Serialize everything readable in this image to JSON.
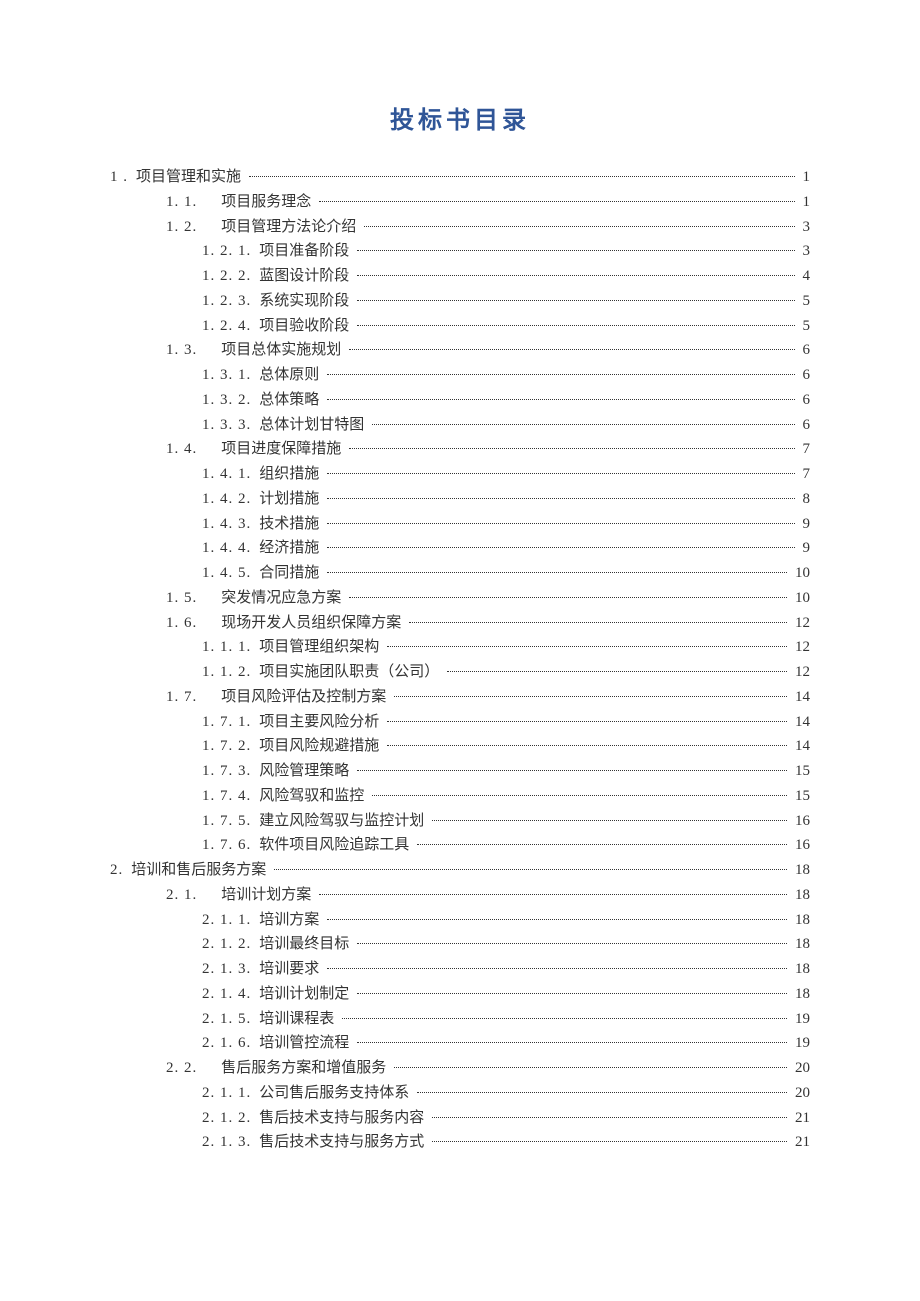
{
  "title": "投标书目录",
  "toc": [
    {
      "indent": 0,
      "num": "1 .",
      "text": "项目管理和实施",
      "page": "1"
    },
    {
      "indent": 1,
      "num": "1. 1.",
      "text": "项目服务理念",
      "page": "1"
    },
    {
      "indent": 1,
      "num": "1. 2.",
      "text": "项目管理方法论介绍",
      "page": "3"
    },
    {
      "indent": 2,
      "num": "1. 2. 1.",
      "text": "项目准备阶段",
      "page": "3"
    },
    {
      "indent": 2,
      "num": "1. 2. 2.",
      "text": "蓝图设计阶段",
      "page": "4"
    },
    {
      "indent": 2,
      "num": "1. 2. 3.",
      "text": "系统实现阶段",
      "page": "5"
    },
    {
      "indent": 2,
      "num": "1. 2. 4.",
      "text": "项目验收阶段",
      "page": "5"
    },
    {
      "indent": 1,
      "num": "1. 3.",
      "text": "项目总体实施规划",
      "page": "6"
    },
    {
      "indent": 2,
      "num": "1. 3. 1.",
      "text": "总体原则",
      "page": "6"
    },
    {
      "indent": 2,
      "num": "1. 3. 2.",
      "text": "总体策略",
      "page": "6"
    },
    {
      "indent": 2,
      "num": "1. 3. 3.",
      "text": "总体计划甘特图",
      "page": "6"
    },
    {
      "indent": 1,
      "num": "1. 4.",
      "text": "项目进度保障措施",
      "page": "7"
    },
    {
      "indent": 2,
      "num": "1. 4. 1.",
      "text": "组织措施",
      "page": "7"
    },
    {
      "indent": 2,
      "num": "1. 4. 2.",
      "text": "计划措施",
      "page": "8"
    },
    {
      "indent": 2,
      "num": "1. 4. 3.",
      "text": "技术措施",
      "page": "9"
    },
    {
      "indent": 2,
      "num": "1. 4. 4.",
      "text": "经济措施",
      "page": "9"
    },
    {
      "indent": 2,
      "num": "1. 4. 5.",
      "text": "合同措施",
      "page": "10"
    },
    {
      "indent": 1,
      "num": "1. 5.",
      "text": "突发情况应急方案",
      "page": "10"
    },
    {
      "indent": 1,
      "num": "1.  6.",
      "text": "现场开发人员组织保障方案",
      "page": "12"
    },
    {
      "indent": 2,
      "num": "1. 1. 1.",
      "text": "项目管理组织架构",
      "page": "12"
    },
    {
      "indent": 2,
      "num": "1. 1. 2.",
      "text": "项目实施团队职责（公司）",
      "page": "12"
    },
    {
      "indent": 1,
      "num": "1. 7.",
      "text": "项目风险评估及控制方案",
      "page": "14"
    },
    {
      "indent": 2,
      "num": "1. 7. 1.",
      "text": "项目主要风险分析",
      "page": "14"
    },
    {
      "indent": 2,
      "num": "1. 7. 2.",
      "text": "项目风险规避措施",
      "page": "14"
    },
    {
      "indent": 2,
      "num": "1. 7. 3.",
      "text": "风险管理策略",
      "page": "15"
    },
    {
      "indent": 2,
      "num": "1. 7. 4.",
      "text": "风险驾驭和监控",
      "page": "15"
    },
    {
      "indent": 2,
      "num": "1. 7. 5.",
      "text": "建立风险驾驭与监控计划",
      "page": "16"
    },
    {
      "indent": 2,
      "num": "1. 7. 6.",
      "text": "软件项目风险追踪工具",
      "page": "16"
    },
    {
      "indent": 0,
      "num": "2.",
      "text": "培训和售后服务方案",
      "page": "18"
    },
    {
      "indent": 1,
      "num": "2. 1.",
      "text": "培训计划方案",
      "page": "18"
    },
    {
      "indent": 2,
      "num": "2. 1. 1.",
      "text": "培训方案",
      "page": "18"
    },
    {
      "indent": 2,
      "num": "2. 1. 2.",
      "text": "培训最终目标",
      "page": "18"
    },
    {
      "indent": 2,
      "num": "2. 1. 3.",
      "text": "培训要求",
      "page": "18"
    },
    {
      "indent": 2,
      "num": "2. 1. 4.",
      "text": "培训计划制定",
      "page": "18"
    },
    {
      "indent": 2,
      "num": "2. 1. 5.",
      "text": "培训课程表",
      "page": "19"
    },
    {
      "indent": 2,
      "num": "2. 1. 6.",
      "text": "培训管控流程",
      "page": "19"
    },
    {
      "indent": 1,
      "num": "2.  2.",
      "text": "售后服务方案和增值服务",
      "page": "20"
    },
    {
      "indent": 2,
      "num": "2. 1. 1.",
      "text": "公司售后服务支持体系",
      "page": "20"
    },
    {
      "indent": 2,
      "num": "2. 1. 2.",
      "text": "售后技术支持与服务内容",
      "page": "21"
    },
    {
      "indent": 2,
      "num": "2. 1. 3.",
      "text": "售后技术支持与服务方式",
      "page": "21"
    }
  ]
}
